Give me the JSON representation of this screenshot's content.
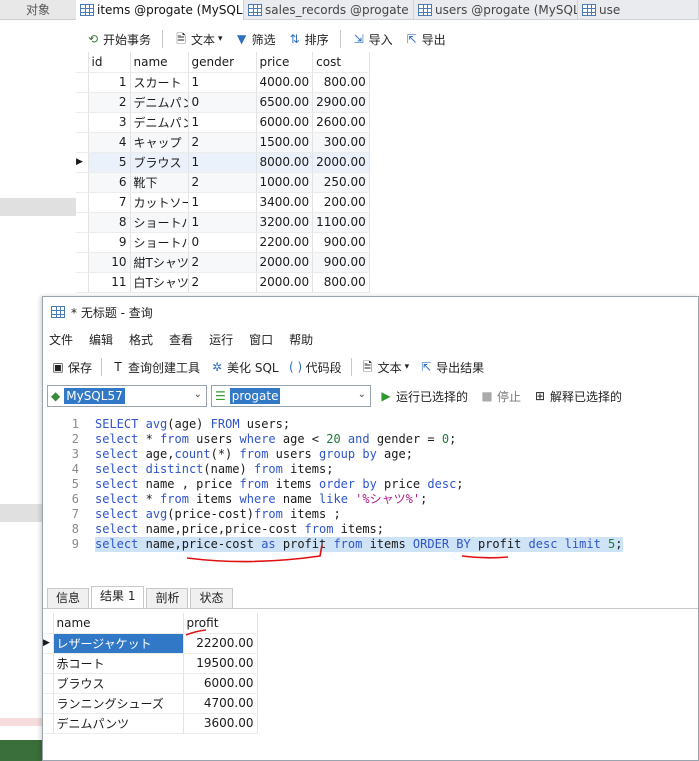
{
  "background": {
    "left_tab_label": "对象"
  },
  "tabs": [
    {
      "label": "items @progate (MySQL...",
      "active": true
    },
    {
      "label": "sales_records @progate (...",
      "active": false
    },
    {
      "label": "users @progate (MySQL...",
      "active": false
    },
    {
      "label": "use",
      "active": false
    }
  ],
  "toolbar": {
    "begin_transaction": "开始事务",
    "text": "文本",
    "filter": "筛选",
    "sort": "排序",
    "import": "导入",
    "export": "导出"
  },
  "items_grid": {
    "columns": [
      "id",
      "name",
      "gender",
      "price",
      "cost"
    ],
    "rows": [
      [
        "1",
        "スカート",
        "1",
        "4000.00",
        "800.00"
      ],
      [
        "2",
        "デニムパンツ",
        "0",
        "6500.00",
        "2900.00"
      ],
      [
        "3",
        "デニムパンツ",
        "1",
        "6000.00",
        "2600.00"
      ],
      [
        "4",
        "キャップ",
        "2",
        "1500.00",
        "300.00"
      ],
      [
        "5",
        "ブラウス",
        "1",
        "8000.00",
        "2000.00"
      ],
      [
        "6",
        "靴下",
        "2",
        "1000.00",
        "250.00"
      ],
      [
        "7",
        "カットソー",
        "1",
        "3400.00",
        "200.00"
      ],
      [
        "8",
        "ショートパンツ",
        "1",
        "3200.00",
        "1100.00"
      ],
      [
        "9",
        "ショートパンツ",
        "0",
        "2200.00",
        "900.00"
      ],
      [
        "10",
        "紺Tシャツ",
        "2",
        "2000.00",
        "900.00"
      ],
      [
        "11",
        "白Tシャツ",
        "2",
        "2000.00",
        "800.00"
      ]
    ],
    "current_row_index": 4
  },
  "query_window": {
    "title": "* 无标题 - 查询",
    "menu": [
      "文件",
      "编辑",
      "格式",
      "查看",
      "运行",
      "窗口",
      "帮助"
    ],
    "toolbar": {
      "save": "保存",
      "query_builder": "查询创建工具",
      "beautify": "美化 SQL",
      "code_snippet": "代码段",
      "text": "文本",
      "export_result": "导出结果"
    },
    "connection": "MySQL57",
    "database": "progate",
    "run_selected": "运行已选择的",
    "stop": "停止",
    "explain_selected": "解释已选择的"
  },
  "editor": {
    "lines": [
      {
        "n": "1",
        "text": "SELECT avg(age) FROM users;"
      },
      {
        "n": "2",
        "text": "select * from users where age < 20 and gender = 0;"
      },
      {
        "n": "3",
        "text": "select age,count(*) from users group by age;"
      },
      {
        "n": "4",
        "text": "select distinct(name) from items;"
      },
      {
        "n": "5",
        "text": "select name , price from items order by price desc;"
      },
      {
        "n": "6",
        "text": "select * from items where name like '%シャツ%';"
      },
      {
        "n": "7",
        "text": "select avg(price-cost)from items ;"
      },
      {
        "n": "8",
        "text": "select name,price,price-cost from items;"
      },
      {
        "n": "9",
        "text": "select name,price-cost as profit from items ORDER BY profit desc limit 5;"
      }
    ],
    "selected_line": 9
  },
  "result_tabs": [
    "信息",
    "结果 1",
    "剖析",
    "状态"
  ],
  "result_grid": {
    "columns": [
      "name",
      "profit"
    ],
    "rows": [
      [
        "レザージャケット",
        "22200.00"
      ],
      [
        "赤コート",
        "19500.00"
      ],
      [
        "ブラウス",
        "6000.00"
      ],
      [
        "ランニングシューズ",
        "4700.00"
      ],
      [
        "デニムパンツ",
        "3600.00"
      ]
    ]
  },
  "colors": {
    "selection": "#3178c6",
    "keyword": "#2f55c8",
    "string": "#b01c8a",
    "annotation": "#e01010"
  }
}
